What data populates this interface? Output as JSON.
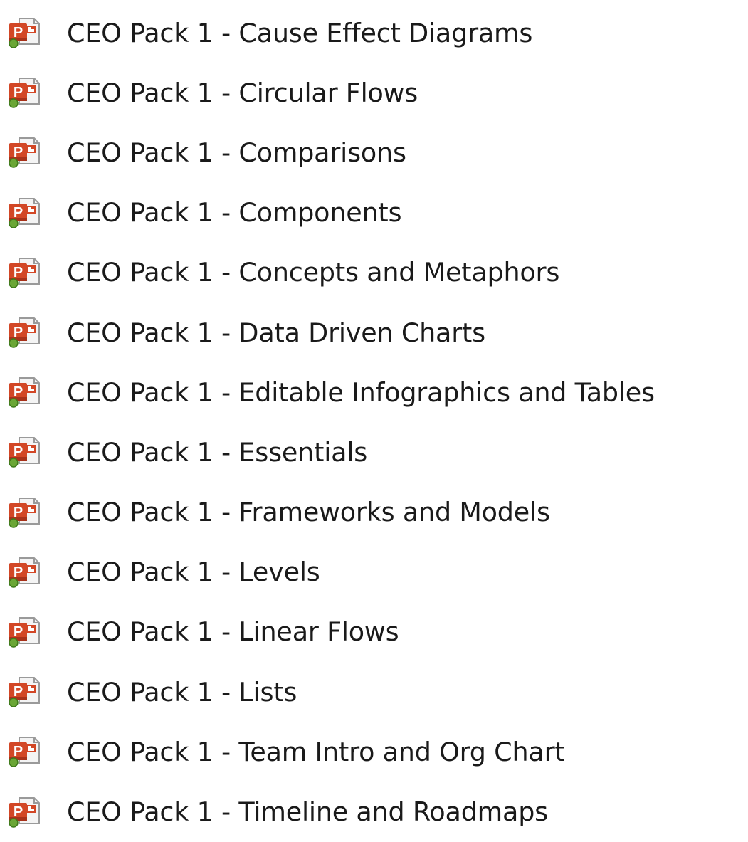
{
  "files": [
    {
      "name": "CEO Pack 1 - Cause Effect Diagrams",
      "icon": "powerpoint-file-icon"
    },
    {
      "name": "CEO Pack 1 - Circular Flows",
      "icon": "powerpoint-file-icon"
    },
    {
      "name": "CEO Pack 1 - Comparisons",
      "icon": "powerpoint-file-icon"
    },
    {
      "name": "CEO Pack 1 - Components",
      "icon": "powerpoint-file-icon"
    },
    {
      "name": "CEO Pack 1 - Concepts and Metaphors",
      "icon": "powerpoint-file-icon"
    },
    {
      "name": "CEO Pack 1 - Data Driven Charts",
      "icon": "powerpoint-file-icon"
    },
    {
      "name": "CEO Pack 1 - Editable Infographics and Tables",
      "icon": "powerpoint-file-icon"
    },
    {
      "name": "CEO Pack 1 - Essentials",
      "icon": "powerpoint-file-icon"
    },
    {
      "name": "CEO Pack 1 - Frameworks and Models",
      "icon": "powerpoint-file-icon"
    },
    {
      "name": "CEO Pack 1 - Levels",
      "icon": "powerpoint-file-icon"
    },
    {
      "name": "CEO Pack 1 - Linear Flows",
      "icon": "powerpoint-file-icon"
    },
    {
      "name": "CEO Pack 1 - Lists",
      "icon": "powerpoint-file-icon"
    },
    {
      "name": "CEO Pack 1 - Team Intro and Org Chart",
      "icon": "powerpoint-file-icon"
    },
    {
      "name": "CEO Pack 1 - Timeline and Roadmaps",
      "icon": "powerpoint-file-icon"
    }
  ],
  "colors": {
    "icon_red": "#d24726",
    "icon_dark_red": "#a8321a",
    "icon_page": "#f4f4f4",
    "icon_page_border": "#9a9a9a",
    "icon_green_dot": "#6aa636",
    "text": "#1a1a1a"
  }
}
